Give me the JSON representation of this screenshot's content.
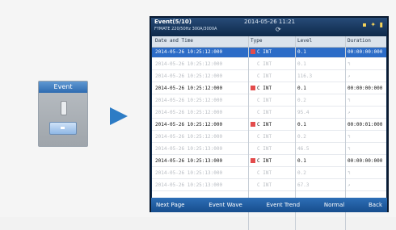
{
  "event_widget": {
    "title": "Event"
  },
  "screen": {
    "title": "Event(5/10)",
    "subtitle": "FYMATE      220/50Hz  300A/3000A",
    "date": "2014-05-26 11:21",
    "icons": "▪ ✦ ▮",
    "columns": [
      "Date and Time",
      "Type",
      "Level",
      "Duration"
    ],
    "rows": [
      {
        "datetime": "2014-05-26 10:25:12:000",
        "type": "C INT",
        "level": "0.1",
        "duration": "00:00:00:000",
        "style": "sel",
        "dot": true
      },
      {
        "datetime": "2014-05-26 10:25:12:000",
        "type": "C INT",
        "level": "0.1",
        "duration": "↰",
        "style": "dim",
        "dot": false
      },
      {
        "datetime": "2014-05-26 10:25:12:000",
        "type": "C INT",
        "level": "116.3",
        "duration": "↗",
        "style": "dim",
        "dot": false
      },
      {
        "datetime": "2014-05-26 10:25:12:000",
        "type": "C INT",
        "level": "0.1",
        "duration": "00:00:00:000",
        "style": "bold",
        "dot": true
      },
      {
        "datetime": "2014-05-26 10:25:12:000",
        "type": "C INT",
        "level": "0.2",
        "duration": "↰",
        "style": "dim",
        "dot": false
      },
      {
        "datetime": "2014-05-26 10:25:12:000",
        "type": "C INT",
        "level": "95.4",
        "duration": "↗",
        "style": "dim",
        "dot": false
      },
      {
        "datetime": "2014-05-26 10:25:12:000",
        "type": "C INT",
        "level": "0.1",
        "duration": "00:00:01:000",
        "style": "bold",
        "dot": true
      },
      {
        "datetime": "2014-05-26 10:25:12:000",
        "type": "C INT",
        "level": "0.2",
        "duration": "↰",
        "style": "dim",
        "dot": false
      },
      {
        "datetime": "2014-05-26 10:25:13:000",
        "type": "C INT",
        "level": "46.5",
        "duration": "↰",
        "style": "dim",
        "dot": false
      },
      {
        "datetime": "2014-05-26 10:25:13:000",
        "type": "C INT",
        "level": "0.1",
        "duration": "00:00:00:000",
        "style": "bold",
        "dot": true
      },
      {
        "datetime": "2014-05-26 10:25:13:000",
        "type": "C INT",
        "level": "0.2",
        "duration": "↰",
        "style": "dim",
        "dot": false
      },
      {
        "datetime": "2014-05-26 10:25:13:000",
        "type": "C INT",
        "level": "67.3",
        "duration": "↗",
        "style": "dim",
        "dot": false
      }
    ],
    "footer": [
      "Next Page",
      "Event Wave",
      "Event Trend",
      "Normal",
      "Back"
    ]
  },
  "colors": {
    "accent": "#2c6cc7",
    "header": "#0f2b4c",
    "footer": "#174d8d",
    "event_dot": "#e34c4c"
  }
}
